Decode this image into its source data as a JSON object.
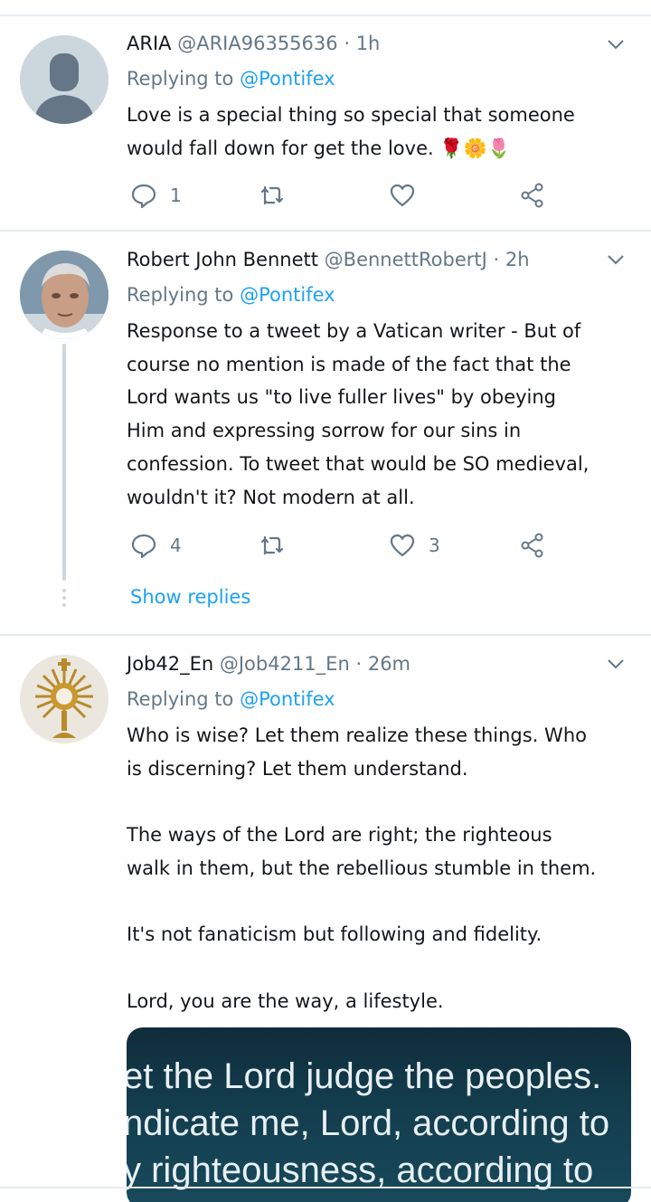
{
  "tweets": [
    {
      "name": "ARIA",
      "handle": "@ARIA96355636",
      "dot": "·",
      "time": "1h",
      "replying_prefix": "Replying to",
      "replying_to": "@Pontifex",
      "text_lines": [
        "Love is a special thing so special that someone",
        "would fall down for get the love. 🌹🌼🌷"
      ],
      "reply_count": "1",
      "retweet_count": "",
      "like_count": ""
    },
    {
      "name": "Robert John Bennett",
      "handle": "@BennettRobertJ",
      "dot": "·",
      "time": "2h",
      "replying_prefix": "Replying to",
      "replying_to": "@Pontifex",
      "text_lines": [
        "Response to a tweet by a Vatican writer - But of",
        "course no mention is made of the fact that the",
        "Lord wants us \"to live fuller lives\" by obeying",
        "Him and expressing sorrow for our sins in",
        "confession. To tweet that would be SO medieval,",
        "wouldn't it? Not modern at all."
      ],
      "reply_count": "4",
      "retweet_count": "",
      "like_count": "3",
      "show_replies": "Show replies"
    },
    {
      "name": "Job42_En",
      "handle": "@Job4211_En",
      "dot": "·",
      "time": "26m",
      "replying_prefix": "Replying to",
      "replying_to": "@Pontifex",
      "text_lines": [
        "Who is wise? Let them realize these things. Who",
        "is discerning? Let them understand.",
        "",
        "The ways of the Lord are right; the righteous",
        "walk in them, but the rebellious stumble in them.",
        "",
        "It's not fanaticism but following and fidelity.",
        "",
        "Lord, you are the way, a lifestyle."
      ],
      "media_lines": [
        "et the Lord judge the peoples.",
        "ndicate me, Lord, according to",
        "y righteousness, according to"
      ]
    }
  ],
  "colors": {
    "accent": "#1da1f2",
    "secondary_text": "#657786",
    "divider": "#e6ecf0"
  }
}
